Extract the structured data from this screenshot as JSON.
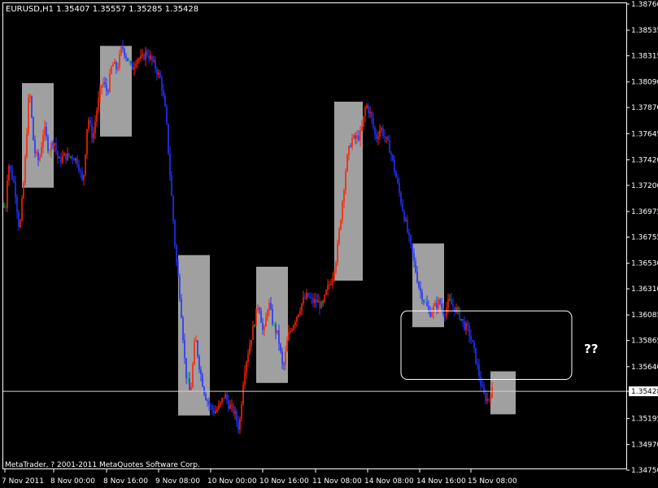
{
  "chart_data": {
    "type": "candlestick",
    "title": "EURUSD,H1  1.35407 1.35557 1.35285 1.35428",
    "copyright": "MetaTrader, ? 2001-2011 MetaQuotes Software Corp.",
    "annotation": "??",
    "ylim": [
      1.3475,
      1.3876
    ],
    "yticks": [
      "1.38760",
      "1.38535",
      "1.38315",
      "1.38090",
      "1.37870",
      "1.37645",
      "1.37420",
      "1.37200",
      "1.36975",
      "1.36755",
      "1.36530",
      "1.36310",
      "1.36085",
      "1.35865",
      "1.35640",
      "1.35428",
      "1.35195",
      "1.34970",
      "1.34750"
    ],
    "current_price": "1.35428",
    "xticks": [
      "7 Nov 2011",
      "8 Nov 00:00",
      "8 Nov 16:00",
      "9 Nov 08:00",
      "10 Nov 00:00",
      "10 Nov 16:00",
      "11 Nov 08:00",
      "14 Nov 08:00",
      "14 Nov 16:00",
      "15 Nov 08:00"
    ],
    "colors": {
      "up": "#ff2200",
      "down": "#2233ff",
      "neutral": "#00cc00",
      "box": "#a0a0a0",
      "grid": "#ffffff",
      "background": "#000000"
    },
    "path": [
      [
        0,
        1.376
      ],
      [
        6,
        1.369
      ],
      [
        10,
        1.374
      ],
      [
        18,
        1.372
      ],
      [
        24,
        1.368
      ],
      [
        30,
        1.373
      ],
      [
        36,
        1.3805
      ],
      [
        42,
        1.375
      ],
      [
        48,
        1.374
      ],
      [
        54,
        1.377
      ],
      [
        60,
        1.375
      ],
      [
        66,
        1.376
      ],
      [
        72,
        1.374
      ],
      [
        78,
        1.3745
      ],
      [
        84,
        1.3745
      ],
      [
        90,
        1.3745
      ],
      [
        96,
        1.374
      ],
      [
        102,
        1.372
      ],
      [
        108,
        1.378
      ],
      [
        114,
        1.376
      ],
      [
        120,
        1.379
      ],
      [
        126,
        1.381
      ],
      [
        132,
        1.38
      ],
      [
        138,
        1.3825
      ],
      [
        144,
        1.382
      ],
      [
        150,
        1.384
      ],
      [
        156,
        1.383
      ],
      [
        162,
        1.382
      ],
      [
        168,
        1.383
      ],
      [
        174,
        1.3828
      ],
      [
        180,
        1.3835
      ],
      [
        186,
        1.3828
      ],
      [
        192,
        1.382
      ],
      [
        198,
        1.381
      ],
      [
        204,
        1.378
      ],
      [
        210,
        1.372
      ],
      [
        216,
        1.366
      ],
      [
        222,
        1.362
      ],
      [
        228,
        1.356
      ],
      [
        234,
        1.354
      ],
      [
        240,
        1.359
      ],
      [
        246,
        1.356
      ],
      [
        252,
        1.354
      ],
      [
        258,
        1.353
      ],
      [
        264,
        1.3525
      ],
      [
        270,
        1.353
      ],
      [
        276,
        1.354
      ],
      [
        282,
        1.353
      ],
      [
        288,
        1.3525
      ],
      [
        294,
        1.351
      ],
      [
        300,
        1.356
      ],
      [
        306,
        1.358
      ],
      [
        312,
        1.36
      ],
      [
        318,
        1.362
      ],
      [
        324,
        1.359
      ],
      [
        330,
        1.362
      ],
      [
        336,
        1.36
      ],
      [
        342,
        1.359
      ],
      [
        348,
        1.356
      ],
      [
        354,
        1.359
      ],
      [
        360,
        1.36
      ],
      [
        366,
        1.361
      ],
      [
        372,
        1.362
      ],
      [
        378,
        1.3625
      ],
      [
        384,
        1.362
      ],
      [
        390,
        1.362
      ],
      [
        396,
        1.3615
      ],
      [
        402,
        1.363
      ],
      [
        408,
        1.364
      ],
      [
        414,
        1.366
      ],
      [
        420,
        1.37
      ],
      [
        426,
        1.374
      ],
      [
        432,
        1.376
      ],
      [
        438,
        1.376
      ],
      [
        444,
        1.3765
      ],
      [
        450,
        1.379
      ],
      [
        456,
        1.378
      ],
      [
        462,
        1.376
      ],
      [
        468,
        1.377
      ],
      [
        474,
        1.376
      ],
      [
        480,
        1.375
      ],
      [
        486,
        1.373
      ],
      [
        492,
        1.371
      ],
      [
        498,
        1.369
      ],
      [
        504,
        1.367
      ],
      [
        510,
        1.365
      ],
      [
        516,
        1.363
      ],
      [
        522,
        1.362
      ],
      [
        528,
        1.361
      ],
      [
        534,
        1.3615
      ],
      [
        540,
        1.362
      ],
      [
        546,
        1.361
      ],
      [
        552,
        1.362
      ],
      [
        558,
        1.3615
      ],
      [
        564,
        1.361
      ],
      [
        570,
        1.36
      ],
      [
        576,
        1.3595
      ],
      [
        582,
        1.358
      ],
      [
        588,
        1.356
      ],
      [
        594,
        1.354
      ],
      [
        600,
        1.3535
      ],
      [
        604,
        1.3543
      ]
    ],
    "boxes": [
      {
        "x0": 27,
        "x1": 66,
        "high": 1.3808,
        "low": 1.3718
      },
      {
        "x0": 123,
        "x1": 162,
        "high": 1.384,
        "low": 1.3762
      },
      {
        "x0": 219,
        "x1": 258,
        "high": 1.366,
        "low": 1.3522
      },
      {
        "x0": 315,
        "x1": 354,
        "high": 1.365,
        "low": 1.355
      },
      {
        "x0": 411,
        "x1": 446,
        "high": 1.3792,
        "low": 1.3638
      },
      {
        "x0": 507,
        "x1": 546,
        "high": 1.367,
        "low": 1.3598
      },
      {
        "x0": 603,
        "x1": 634,
        "high": 1.356,
        "low": 1.3523
      }
    ],
    "highlight": {
      "x0": 493,
      "x1": 703,
      "high": 1.3612,
      "low": 1.3553
    }
  }
}
